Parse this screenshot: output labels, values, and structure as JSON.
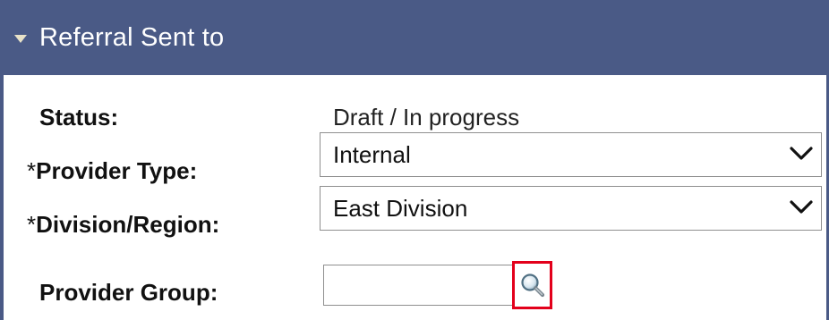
{
  "section": {
    "title": "Referral Sent to",
    "toggle_icon": "collapse-triangle-icon"
  },
  "form": {
    "status": {
      "label": "Status:",
      "value": "Draft / In progress"
    },
    "provider_type": {
      "required_marker": "*",
      "label": "Provider Type:",
      "value": "Internal"
    },
    "division_region": {
      "required_marker": "*",
      "label": "Division/Region:",
      "value": "East Division"
    },
    "provider_group": {
      "label": "Provider Group:",
      "value": "",
      "lookup_icon": "magnifier-icon"
    }
  },
  "colors": {
    "header_bg": "#4a5a86",
    "lookup_highlight": "#e3001b"
  }
}
